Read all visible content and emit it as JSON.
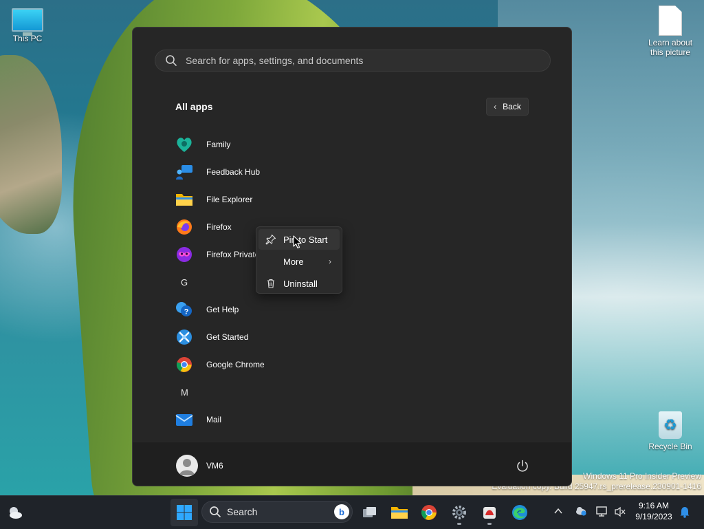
{
  "desktop": {
    "icons": [
      {
        "label": "This PC"
      },
      {
        "label": "Learn about this picture"
      },
      {
        "label": "Recycle Bin"
      }
    ],
    "watermark": {
      "line1": "Windows 11 Pro Insider Preview",
      "line2": "Evaluation copy. Build 25947.rs_prerelease.230901-1416"
    }
  },
  "start_menu": {
    "search_placeholder": "Search for apps, settings, and documents",
    "title": "All apps",
    "back_label": "Back",
    "apps": [
      {
        "type": "app",
        "name": "Family",
        "icon": "family-icon"
      },
      {
        "type": "app",
        "name": "Feedback Hub",
        "icon": "feedback-hub-icon"
      },
      {
        "type": "app",
        "name": "File Explorer",
        "icon": "file-explorer-icon"
      },
      {
        "type": "app",
        "name": "Firefox",
        "icon": "firefox-icon"
      },
      {
        "type": "app",
        "name": "Firefox Private Browsing",
        "icon": "firefox-private-icon"
      },
      {
        "type": "letter",
        "name": "G"
      },
      {
        "type": "app",
        "name": "Get Help",
        "icon": "get-help-icon"
      },
      {
        "type": "app",
        "name": "Get Started",
        "icon": "get-started-icon"
      },
      {
        "type": "app",
        "name": "Google Chrome",
        "icon": "chrome-icon"
      },
      {
        "type": "letter",
        "name": "M"
      },
      {
        "type": "app",
        "name": "Mail",
        "icon": "mail-icon"
      }
    ],
    "user": {
      "name": "VM6"
    }
  },
  "context_menu": {
    "items": [
      {
        "label": "Pin to Start",
        "icon": "pin-icon"
      },
      {
        "label": "More",
        "icon": ""
      },
      {
        "label": "Uninstall",
        "icon": "trash-icon"
      }
    ]
  },
  "taskbar": {
    "search_label": "Search",
    "clock": {
      "time": "9:16 AM",
      "date": "9/19/2023"
    },
    "colors": {
      "accent": "#0078d4",
      "background": "#1f2329"
    }
  }
}
